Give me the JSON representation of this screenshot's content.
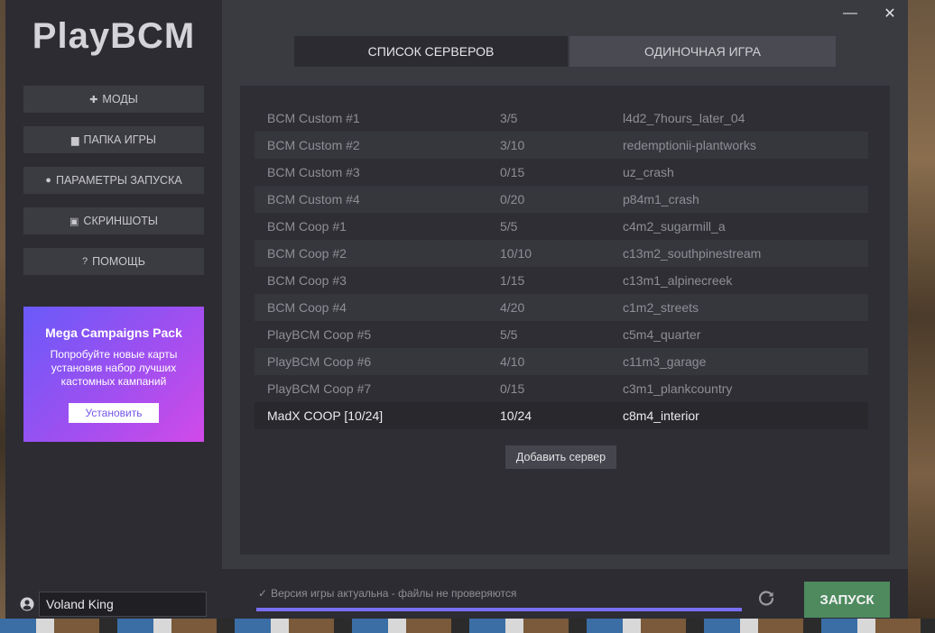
{
  "app": {
    "logo": "PlayBCM"
  },
  "sidebar": {
    "nav": [
      {
        "label": "Моды",
        "icon": "puzzle-icon",
        "glyph": "✚"
      },
      {
        "label": "Папка игры",
        "icon": "folder-icon",
        "glyph": "▆"
      },
      {
        "label": "Параметры запуска",
        "icon": "bulb-icon",
        "glyph": "●"
      },
      {
        "label": "Скриншоты",
        "icon": "image-icon",
        "glyph": "▣"
      },
      {
        "label": "Помощь",
        "icon": "help-icon",
        "glyph": "?"
      }
    ],
    "promo": {
      "title": "Mega Campaigns Pack",
      "text": "Попробуйте новые карты установив набор лучших кастомных кампаний",
      "button": "Установить"
    },
    "user": {
      "name": "Voland King"
    }
  },
  "tabs": [
    {
      "label": "Список серверов",
      "active": true
    },
    {
      "label": "Одиночная игра",
      "active": false
    }
  ],
  "servers": [
    {
      "name": "BCM Custom #1",
      "players": "3/5",
      "map": "l4d2_7hours_later_04"
    },
    {
      "name": "BCM Custom #2",
      "players": "3/10",
      "map": "redemptionii-plantworks"
    },
    {
      "name": "BCM Custom #3",
      "players": "0/15",
      "map": "uz_crash"
    },
    {
      "name": "BCM Custom #4",
      "players": "0/20",
      "map": "p84m1_crash"
    },
    {
      "name": "BCM Coop #1",
      "players": "5/5",
      "map": "c4m2_sugarmill_a"
    },
    {
      "name": "BCM Coop #2",
      "players": "10/10",
      "map": "c13m2_southpinestream"
    },
    {
      "name": "BCM Coop #3",
      "players": "1/15",
      "map": "c13m1_alpinecreek"
    },
    {
      "name": "BCM Coop #4",
      "players": "4/20",
      "map": "c1m2_streets"
    },
    {
      "name": "PlayBCM Coop #5",
      "players": "5/5",
      "map": "c5m4_quarter"
    },
    {
      "name": "PlayBCM Coop #6",
      "players": "4/10",
      "map": "c11m3_garage"
    },
    {
      "name": "PlayBCM Coop #7",
      "players": "0/15",
      "map": "c3m1_plankcountry"
    },
    {
      "name": "MadX COOP [10/24]",
      "players": "10/24",
      "map": "c8m4_interior",
      "highlighted": true
    }
  ],
  "add_server_label": "Добавить сервер",
  "footer": {
    "status": "Версия игры актуальна - файлы не проверяются",
    "progress": 1.0,
    "launch_label": "Запуск"
  },
  "colors": {
    "accent": "#7a6ff0",
    "launch": "#4e8a5e",
    "promo_from": "#6a5af9",
    "promo_to": "#d14ae8"
  }
}
